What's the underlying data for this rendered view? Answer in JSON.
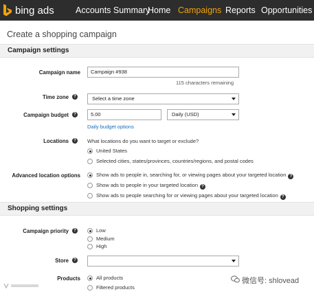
{
  "header": {
    "logo_text": "bing ads",
    "nav": [
      "Accounts Summary",
      "Home",
      "Campaigns",
      "Reports",
      "Opportunities"
    ],
    "active_index": 2,
    "accent_color": "#f0a30a",
    "bar_color": "#2d2d2d"
  },
  "page_title": "Create a shopping campaign",
  "campaign_settings": {
    "section_title": "Campaign settings",
    "campaign_name": {
      "label": "Campaign name",
      "value": "Campaign #938",
      "hint": "115 characters remaining"
    },
    "time_zone": {
      "label": "Time zone",
      "value": "Select a time zone"
    },
    "campaign_budget": {
      "label": "Campaign budget",
      "value": "5.00",
      "type": "Daily (USD)",
      "link": "Daily budget options"
    },
    "locations": {
      "label": "Locations",
      "question": "What locations do you want to target or exclude?",
      "options": [
        "United States",
        "Selected cities, states/provinces, countries/regions, and postal codes"
      ],
      "selected": 0
    },
    "advanced_location": {
      "label": "Advanced location options",
      "options": [
        "Show ads to people in, searching for, or viewing pages about your targeted location",
        "Show ads to people in your targeted location",
        "Show ads to people searching for or viewing pages about your targeted location"
      ],
      "selected": 0
    }
  },
  "shopping_settings": {
    "section_title": "Shopping settings",
    "campaign_priority": {
      "label": "Campaign priority",
      "options": [
        "Low",
        "Medium",
        "High"
      ],
      "selected": 0
    },
    "store": {
      "label": "Store",
      "value": ""
    },
    "products": {
      "label": "Products",
      "options": [
        "All products",
        "Filtered products"
      ],
      "selected": 0
    }
  },
  "watermark": {
    "right": "微信号: shlovead"
  },
  "icons": {
    "help": "help-circle-icon",
    "dropdown": "chevron-down-icon",
    "logo": "bing-logo-icon",
    "watermark": "wechat-icon"
  }
}
